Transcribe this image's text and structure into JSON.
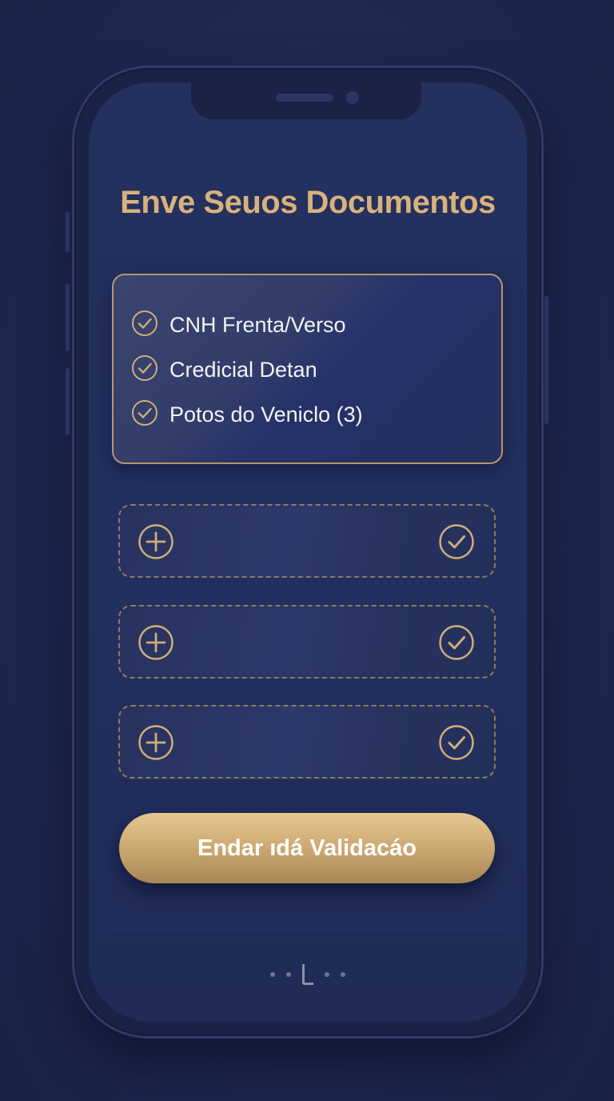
{
  "page": {
    "title": "Enve Seuos Documentos"
  },
  "checklist": {
    "items": [
      {
        "label": "CNH Frenta/Verso",
        "icon": "check-circle-icon",
        "checked": true
      },
      {
        "label": "Credicial Detan",
        "icon": "check-circle-icon",
        "checked": true
      },
      {
        "label": "Potos do Veniclo (3)",
        "icon": "check-circle-icon",
        "checked": true
      }
    ]
  },
  "upload_slots": [
    {
      "add_icon": "plus-circle-icon",
      "status_icon": "check-circle-icon"
    },
    {
      "add_icon": "plus-circle-icon",
      "status_icon": "check-circle-icon"
    },
    {
      "add_icon": "plus-circle-icon",
      "status_icon": "check-circle-icon"
    }
  ],
  "actions": {
    "submit_label": "Endar ıdá Validacáo"
  },
  "colors": {
    "background": "#1f2a50",
    "accent_gold": "#d8b27c",
    "text_light": "#f3f3f6"
  }
}
